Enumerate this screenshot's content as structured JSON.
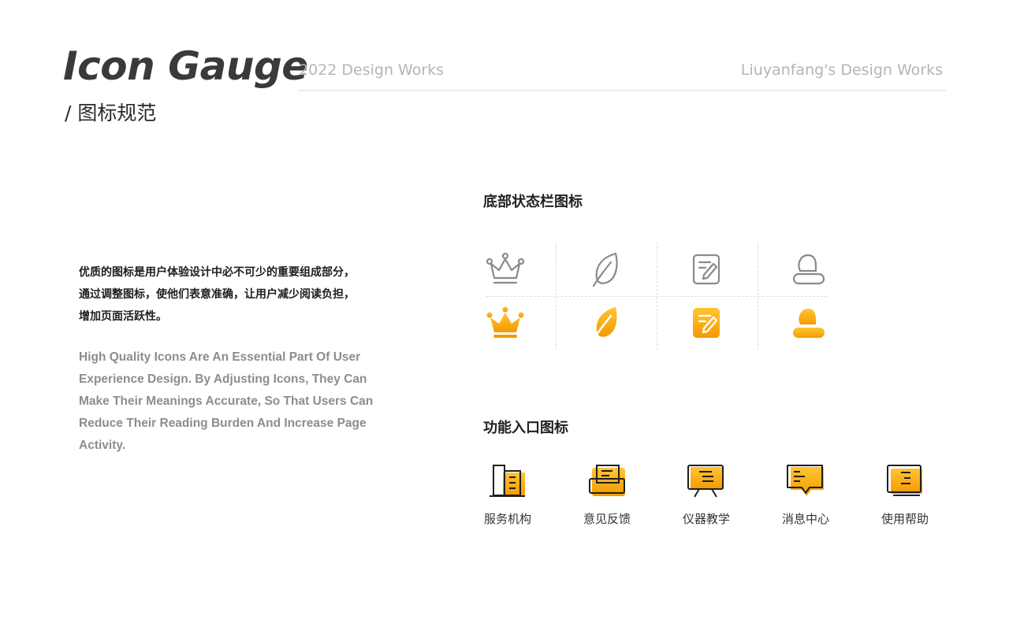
{
  "header": {
    "title": "Icon Gauge",
    "subtitle": "/ 图标规范",
    "year_label": "2022 Design Works",
    "author_label": "Liuyanfang's Design Works"
  },
  "description": {
    "cn_lines": [
      "优质的图标是用户体验设计中必不可少的重要组成部分，",
      "通过调整图标，使他们表意准确，让用户减少阅读负担，",
      "增加页面活跃性。"
    ],
    "en": "High Quality Icons Are An Essential Part Of User Experience Design. By Adjusting Icons, They Can Make Their Meanings Accurate, So That Users Can Reduce Their Reading Burden And Increase Page Activity."
  },
  "status_bar": {
    "title": "底部状态栏图标",
    "icons": [
      "crown-icon",
      "leaf-icon",
      "note-edit-icon",
      "user-icon"
    ]
  },
  "function_entry": {
    "title": "功能入口图标",
    "items": [
      {
        "label": "服务机构",
        "icon": "building-icon"
      },
      {
        "label": "意见反馈",
        "icon": "feedback-icon"
      },
      {
        "label": "仪器教学",
        "icon": "instrument-teaching-icon"
      },
      {
        "label": "消息中心",
        "icon": "message-icon"
      },
      {
        "label": "使用帮助",
        "icon": "help-book-icon"
      }
    ]
  },
  "colors": {
    "accent_light": "#ffc533",
    "accent_dark": "#f59a00",
    "outline": "#8a8a8a",
    "stroke": "#1f1f1f"
  }
}
